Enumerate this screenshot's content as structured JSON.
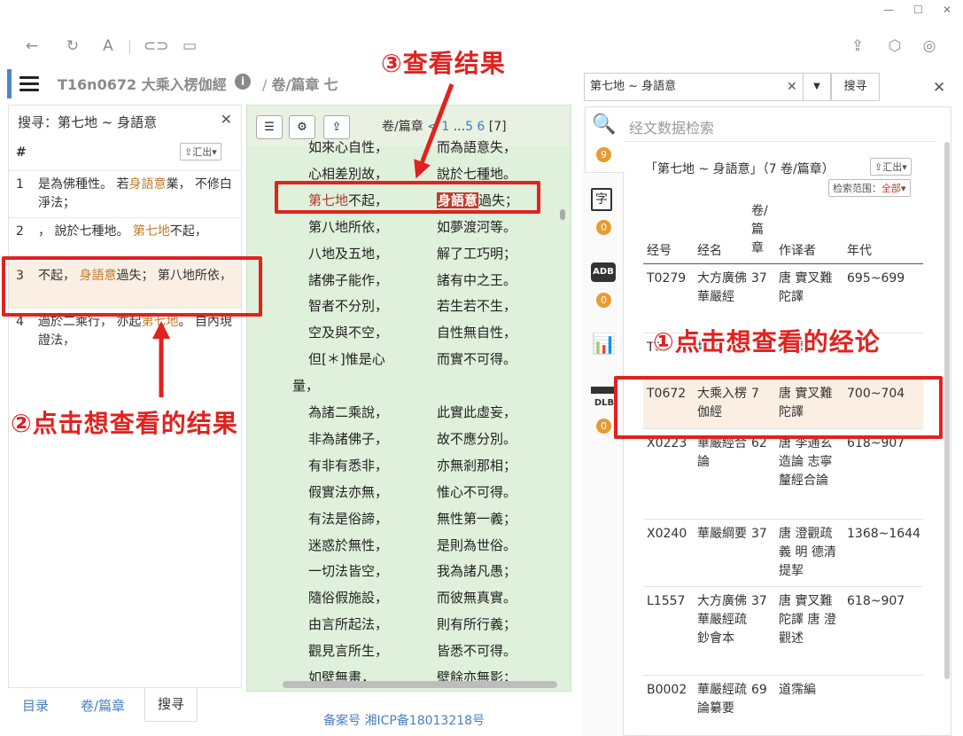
{
  "window": {
    "minimize": "—",
    "maximize": "☐",
    "close": "✕"
  },
  "header": {
    "title": "T16n0672 大乘入楞伽經",
    "info": "i",
    "separator": "/",
    "crumb_label": "卷/篇章",
    "crumb_value": "七"
  },
  "left_panel": {
    "heading": "搜寻：第七地 ~ 身語意",
    "close": "✕",
    "hash": "#",
    "export": "汇出▾",
    "rows": [
      {
        "num": "1",
        "parts": [
          "是為佛種性。 若",
          "身語意",
          "業， 不修白淨法；"
        ]
      },
      {
        "num": "2",
        "parts": [
          "， 說於七種地。 ",
          "第七地",
          "不起，"
        ]
      },
      {
        "num": "3",
        "parts": [
          "不起， ",
          "身語意",
          "過失； 第八地所依，"
        ]
      },
      {
        "num": "4",
        "parts": [
          "過於二乘行， 亦起",
          "第七地",
          "。 自內現證法，"
        ]
      }
    ]
  },
  "bottom_tabs": {
    "toc": "目录",
    "chapter": "卷/篇章",
    "search": "搜寻"
  },
  "middle": {
    "page_label": "卷/篇章",
    "page_prev": "< 1",
    "page_dots": "...",
    "page_links": "5 6",
    "page_current": "[7]",
    "verses": [
      [
        "如來心自性，",
        "而為語意失，"
      ],
      [
        "心相差別故，",
        "說於七種地。"
      ],
      [
        "第七地|不起，",
        "身語意|過失；"
      ],
      [
        "第八地所依，",
        "如夢渡河等。"
      ],
      [
        "八地及五地，",
        "解了工巧明；"
      ],
      [
        "諸佛子能作，",
        "諸有中之王。"
      ],
      [
        "智者不分別，",
        "若生若不生，"
      ],
      [
        "空及與不空，",
        "自性無自性，"
      ],
      [
        "但[＊]惟是心",
        "而實不可得。"
      ],
      [
        "量，",
        ""
      ],
      [
        "為諸二乘說，",
        "此實此虛妄，"
      ],
      [
        "非為諸佛子，",
        "故不應分別。"
      ],
      [
        "有非有悉非，",
        "亦無剎那相；"
      ],
      [
        "假實法亦無，",
        "惟心不可得。"
      ],
      [
        "有法是俗諦，",
        "無性第一義；"
      ],
      [
        "迷惑於無性，",
        "是則為世俗。"
      ],
      [
        "一切法皆空，",
        "我為諸凡愚；"
      ],
      [
        "隨俗假施設，",
        "而彼無真實。"
      ],
      [
        "由言所起法，",
        "則有所行義；"
      ],
      [
        "觀見言所生，",
        "皆悉不可得。"
      ],
      [
        "如壁無畫，",
        "壁餘亦無影；"
      ]
    ]
  },
  "footer": {
    "icp": "备案号 湘ICP备18013218号"
  },
  "right_panel": {
    "search_value": "第七地 ~ 身語意",
    "search_clear": "✕",
    "dropdown": "▼",
    "search_button": "搜寻",
    "close": "✕",
    "title": "经文数据检索",
    "query_summary": "「第七地 ~ 身語意」（7 卷/篇章）",
    "export": "汇出▾",
    "range_label": "检索范围：",
    "range_value": "全部",
    "side_badges": [
      "9",
      "0",
      "0",
      "0"
    ],
    "side_icons": [
      "search-icon",
      "char-icon",
      "adb-icon",
      "chart-icon",
      "dlb-icon"
    ],
    "columns": [
      "经号",
      "经名",
      "卷/篇章",
      "作译者",
      "年代"
    ],
    "rows": [
      {
        "id": "T0279",
        "name": "大方廣佛華嚴經",
        "juan": "37",
        "author": "唐 實叉難陀譯",
        "era": "695~699"
      },
      {
        "id": "T0",
        "name": "地經",
        "juan": "",
        "author": "達摩譯",
        "era": ""
      },
      {
        "id": "T0672",
        "name": "大乘入楞伽經",
        "juan": "7",
        "author": "唐 實叉難陀譯",
        "era": "700~704"
      },
      {
        "id": "X0223",
        "name": "華嚴經合論",
        "juan": "62",
        "author": "唐 李通玄造論 志寧釐經合論",
        "era": "618~907"
      },
      {
        "id": "X0240",
        "name": "華嚴綱要",
        "juan": "37",
        "author": "唐 澄觀疏義 明 德清提挈",
        "era": "1368~1644"
      },
      {
        "id": "L1557",
        "name": "大方廣佛華嚴經疏鈔會本",
        "juan": "37",
        "author": "唐 實叉難陀譯 唐 澄觀述",
        "era": "618~907"
      },
      {
        "id": "B0002",
        "name": "華嚴經疏論纂要",
        "juan": "69",
        "author": "道霈編",
        "era": ""
      }
    ]
  },
  "annotations": {
    "step1": "①点击想查看的经论",
    "step2": "②点击想查看的结果",
    "step3": "③查看结果"
  },
  "colors": {
    "annotation": "#e1221f",
    "highlight": "#c07b2c",
    "accent": "#4a87c5",
    "badge": "#e89a33",
    "reading_bg": "#dff0db"
  }
}
